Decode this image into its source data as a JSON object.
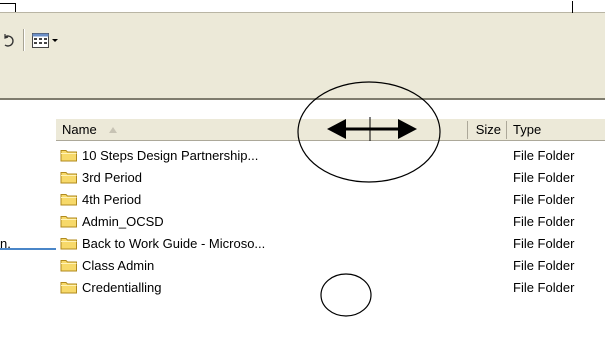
{
  "toolbar": {
    "icons": {
      "undo": "undo-arrow-icon",
      "views": "views-grid-icon",
      "dropdown": "dropdown-arrow-icon"
    }
  },
  "columns": {
    "name": "Name",
    "size": "Size",
    "type": "Type",
    "sort_direction": "ascending"
  },
  "files": [
    {
      "name": "10 Steps Design Partnership...",
      "type": "File Folder",
      "left_pane_text": ""
    },
    {
      "name": "3rd Period",
      "type": "File Folder",
      "left_pane_text": ""
    },
    {
      "name": "4th Period",
      "type": "File Folder",
      "left_pane_text": ""
    },
    {
      "name": "Admin_OCSD",
      "type": "File Folder",
      "left_pane_text": ""
    },
    {
      "name": "Back to Work Guide - Microso...",
      "type": "File Folder",
      "left_pane_text": "n."
    },
    {
      "name": "Class Admin",
      "type": "File Folder",
      "left_pane_text": ""
    },
    {
      "name": "Credentialling",
      "type": "File Folder",
      "left_pane_text": ""
    }
  ],
  "annotations": {
    "resize_cursor": "horizontal-resize-arrow-icon",
    "circle_stroke": "#000000"
  },
  "colors": {
    "chrome": "#ece9d8",
    "folder_fill": "#f7d96a",
    "folder_stroke": "#b08a1e",
    "tree_line": "#4a86c8"
  }
}
